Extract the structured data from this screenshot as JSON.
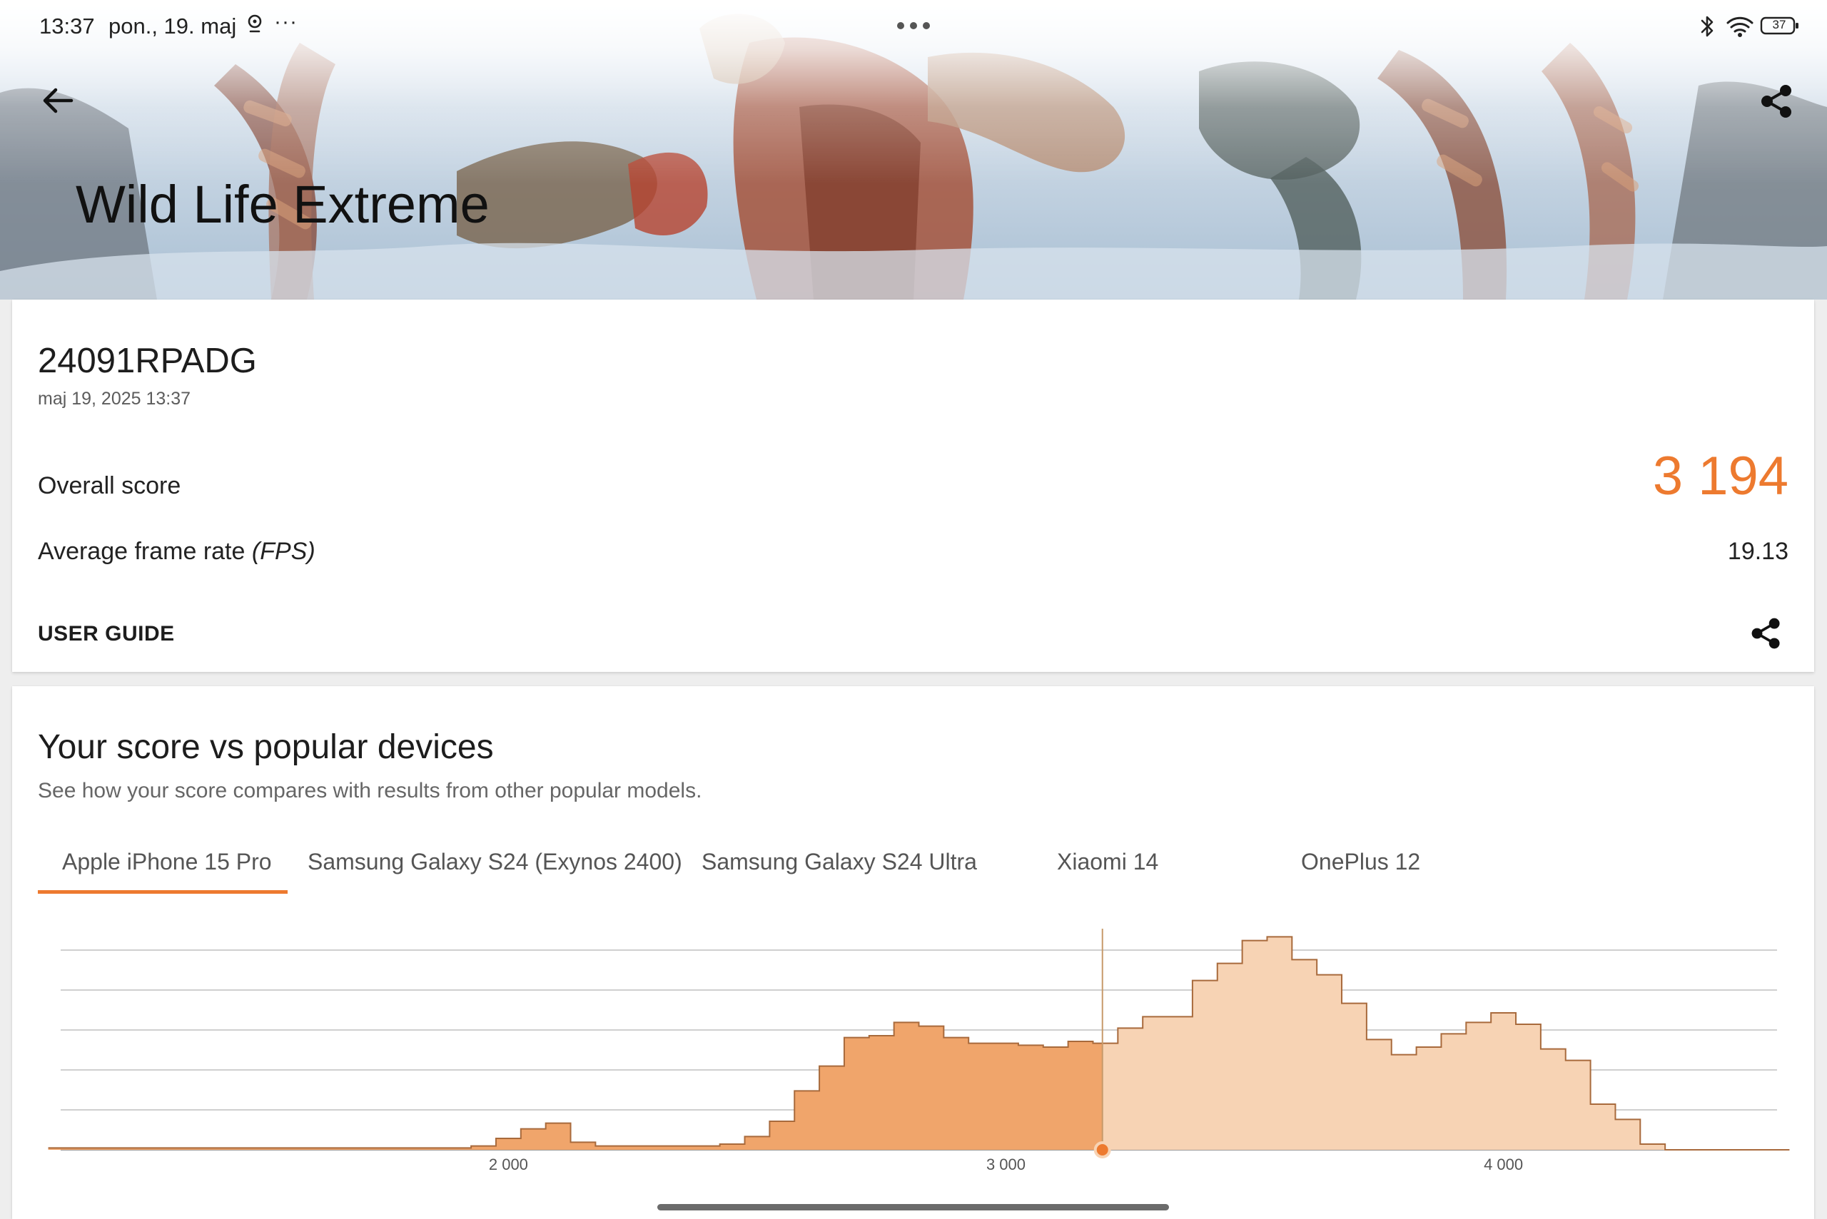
{
  "status_bar": {
    "time": "13:37",
    "date": "pon., 19. maj",
    "more_label": "···",
    "battery_level": "37"
  },
  "header": {
    "title": "Wild Life Extreme"
  },
  "result": {
    "device_name": "24091RPADG",
    "date": "maj 19, 2025 13:37",
    "overall_label": "Overall score",
    "overall_value": "3 194",
    "fps_label": "Average frame rate",
    "fps_unit": "(FPS)",
    "fps_value": "19.13",
    "user_guide_label": "USER GUIDE"
  },
  "comparison": {
    "title": "Your score vs popular devices",
    "subtitle": "See how your score compares with results from other popular models.",
    "tabs": [
      {
        "label": "Apple iPhone 15 Pro",
        "active": true
      },
      {
        "label": "Samsung Galaxy S24 (Exynos 2400)",
        "active": false
      },
      {
        "label": "Samsung Galaxy S24 Ultra",
        "active": false
      },
      {
        "label": "Xiaomi 14",
        "active": false
      },
      {
        "label": "OnePlus 12",
        "active": false
      }
    ]
  },
  "colors": {
    "accent": "#ed7a2f",
    "histogram_below": "#f0a56b",
    "histogram_above": "#f7d3b4"
  },
  "chart_data": {
    "type": "area",
    "xlim": [
      1100,
      4550
    ],
    "ylim": [
      0,
      105
    ],
    "user_score": 3194,
    "x_ticks": [
      "2 000",
      "3 000",
      "4 000"
    ],
    "x": [
      1100,
      1150,
      1200,
      1250,
      1300,
      1350,
      1400,
      1450,
      1500,
      1550,
      1600,
      1650,
      1700,
      1750,
      1800,
      1850,
      1900,
      1950,
      2000,
      2050,
      2100,
      2150,
      2200,
      2250,
      2300,
      2350,
      2400,
      2450,
      2500,
      2550,
      2600,
      2650,
      2700,
      2750,
      2800,
      2850,
      2900,
      2950,
      3000,
      3050,
      3100,
      3150,
      3200,
      3250,
      3300,
      3350,
      3400,
      3450,
      3500,
      3550,
      3600,
      3650,
      3700,
      3750,
      3800,
      3850,
      3900,
      3950,
      4000,
      4050,
      4100,
      4150,
      4200,
      4250,
      4300,
      4350,
      4400,
      4450,
      4500,
      4550
    ],
    "values": [
      1,
      1,
      1,
      1,
      1,
      1,
      1,
      1,
      1,
      1,
      1,
      1,
      1,
      1,
      1,
      1,
      1,
      2,
      6,
      11,
      14,
      4,
      2,
      2,
      2,
      2,
      2,
      3,
      7,
      15,
      31,
      44,
      59,
      60,
      67,
      65,
      59,
      56,
      56,
      55,
      54,
      57,
      56,
      64,
      70,
      70,
      89,
      98,
      110,
      112,
      100,
      92,
      77,
      58,
      50,
      54,
      61,
      67,
      72,
      66,
      53,
      47,
      24,
      16,
      3,
      0,
      0,
      0,
      0,
      0
    ]
  }
}
